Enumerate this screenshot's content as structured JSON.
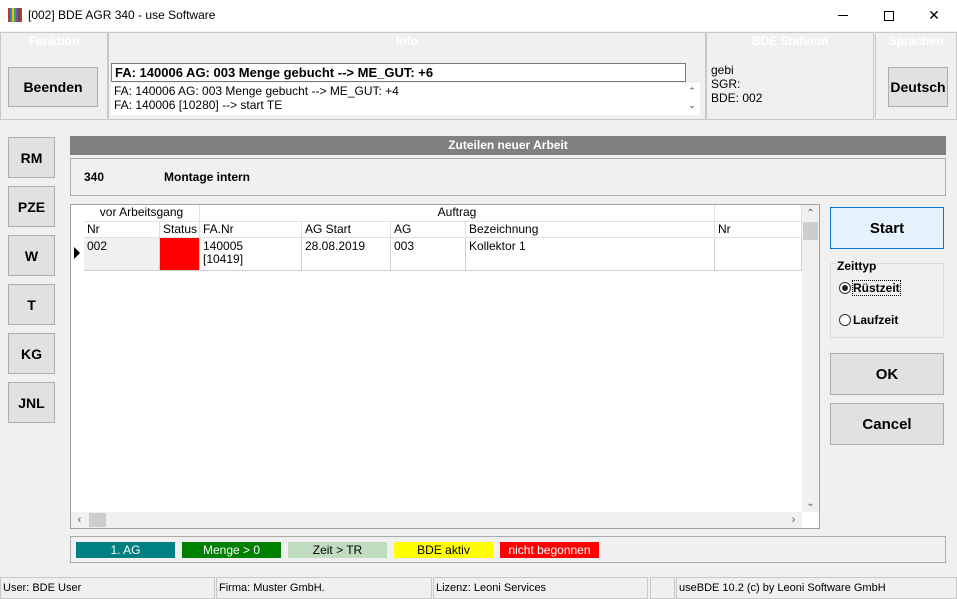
{
  "window": {
    "title": "[002] BDE AGR 340 - use Software"
  },
  "panels": {
    "funktion": {
      "header": "Funktion",
      "beenden_label": "Beenden"
    },
    "info": {
      "header": "Info",
      "current": "FA: 140006 AG: 003 Menge gebucht --> ME_GUT: +6",
      "log": [
        "FA: 140006 AG: 003 Menge gebucht --> ME_GUT: +4",
        "FA: 140006 [10280] --> start TE"
      ]
    },
    "station": {
      "header": "BDE Statinon",
      "lines": [
        "gebi",
        "SGR:",
        "BDE: 002"
      ]
    },
    "sprachen": {
      "header": "Sprachen",
      "language_label": "Deutsch"
    }
  },
  "sidebar": {
    "items": [
      "RM",
      "PZE",
      "W",
      "T",
      "KG",
      "JNL"
    ]
  },
  "assign": {
    "header": "Zuteilen neuer Arbeit",
    "op_number": "340",
    "op_name": "Montage intern"
  },
  "grid": {
    "group_headers": [
      "vor Arbeitsgang",
      "Auftrag"
    ],
    "columns": [
      "Nr",
      "Status",
      "FA.Nr",
      "AG Start",
      "AG",
      "Bezeichnung",
      "Nr"
    ],
    "rows": [
      {
        "nr": "002",
        "status_color": "#ff0000",
        "fa_nr": "140005",
        "fa_sub": "[10419]",
        "ag_start": "28.08.2019",
        "ag": "003",
        "bezeichnung": "Kollektor 1",
        "nr2": ""
      }
    ]
  },
  "actions": {
    "start_label": "Start",
    "zeittyp_label": "Zeittyp",
    "radio_ruestzeit": "Rüstzeit",
    "radio_laufzeit": "Laufzeit",
    "selected": "Rüstzeit",
    "ok_label": "OK",
    "cancel_label": "Cancel"
  },
  "legend": [
    {
      "label": "1. AG",
      "color": "#008080"
    },
    {
      "label": "Menge > 0",
      "color": "#008000"
    },
    {
      "label": "Zeit > TR",
      "color": "#c0dcc0"
    },
    {
      "label": "BDE aktiv",
      "color": "#ffff00"
    },
    {
      "label": "nicht begonnen",
      "color": "#ff0000"
    }
  ],
  "statusbar": {
    "user": "User: BDE User",
    "firma": "Firma: Muster GmbH.",
    "lizenz": "Lizenz: Leoni Services",
    "version": "useBDE 10.2 (c) by Leoni Software GmbH"
  }
}
